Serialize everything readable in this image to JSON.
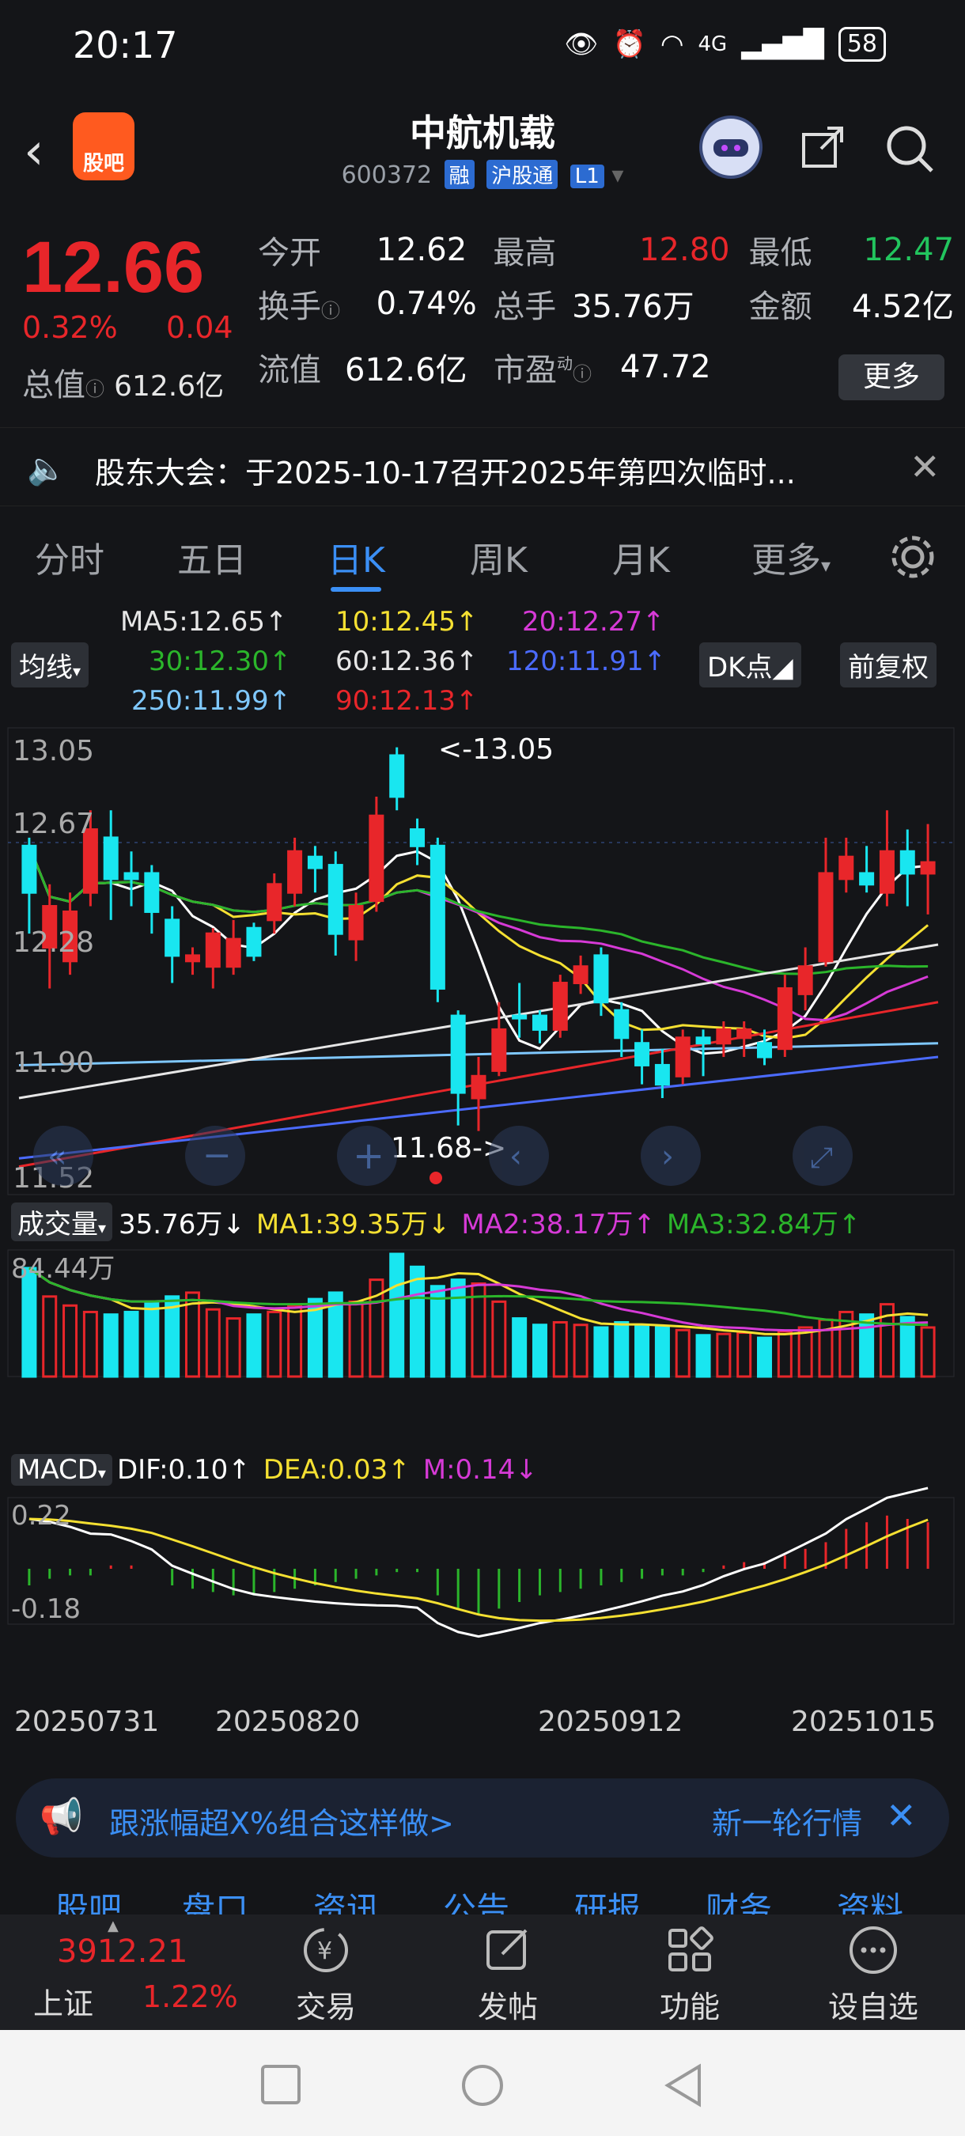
{
  "status_bar": {
    "time": "20:17",
    "network": "4G",
    "battery": "58"
  },
  "header": {
    "back_icon": "chevron-left-icon",
    "logo_text": "股吧",
    "title": "中航机载",
    "code": "600372",
    "tags": [
      "融",
      "沪股通",
      "L1"
    ],
    "icons": [
      "robot-avatar-icon",
      "share-icon",
      "search-icon"
    ]
  },
  "quote": {
    "price": "12.66",
    "change_pct": "0.32%",
    "change_abs": "0.04",
    "rows": [
      [
        {
          "label": "今开",
          "value": "12.62",
          "color": "#ffffff"
        },
        {
          "label": "最高",
          "value": "12.80",
          "color": "#e8262a"
        },
        {
          "label": "最低",
          "value": "12.47",
          "color": "#22c55e"
        }
      ],
      [
        {
          "label": "换手",
          "value": "0.74%",
          "color": "#ffffff"
        },
        {
          "label": "总手",
          "value": "35.76万",
          "color": "#ffffff"
        },
        {
          "label": "金额",
          "value": "4.52亿",
          "color": "#ffffff"
        }
      ]
    ],
    "total_value_label": "总值",
    "total_value": "612.6亿",
    "float_label": "流值",
    "float_value": "612.6亿",
    "pe_label": "市盈",
    "pe_sup": "动",
    "pe_value": "47.72",
    "more_label": "更多"
  },
  "notice": {
    "text": "股东大会：于2025-10-17召开2025年第四次临时..."
  },
  "tabs": [
    "分时",
    "五日",
    "日K",
    "周K",
    "月K",
    "更多"
  ],
  "active_tab": "日K",
  "ma_legend": {
    "selector": "均线",
    "items": [
      {
        "text": "MA5:12.65↑",
        "color": "#ffffff"
      },
      {
        "text": "10:12.45↑",
        "color": "#f5e032"
      },
      {
        "text": "20:12.27↑",
        "color": "#d63ad6"
      },
      {
        "text": "30:12.30↑",
        "color": "#2bb52b"
      },
      {
        "text": "60:12.36↑",
        "color": "#e6e6e6"
      },
      {
        "text": "120:11.91↑",
        "color": "#4b6bff"
      },
      {
        "text": "250:11.99↑",
        "color": "#7fc8ff"
      },
      {
        "text": "90:12.13↑",
        "color": "#e8262a"
      }
    ],
    "dk_button": "DK点",
    "adjust_button": "前复权"
  },
  "kline": {
    "y_labels": [
      "13.05",
      "12.67",
      "12.28",
      "11.90",
      "11.52"
    ],
    "high_annotation": "<-13.05",
    "low_annotation": "11.68->"
  },
  "volume_legend": {
    "selector": "成交量",
    "value": "35.76万↓",
    "ma1": "MA1:39.35万↓",
    "ma2": "MA2:38.17万↑",
    "ma3": "MA3:32.84万↑",
    "y_label": "84.44万"
  },
  "macd_legend": {
    "selector": "MACD",
    "dif": "DIF:0.10↑",
    "dea": "DEA:0.03↑",
    "m": "M:0.14↓",
    "y_top": "0.22",
    "y_bottom": "-0.18"
  },
  "dates": [
    "20250731",
    "20250820",
    "20250912",
    "20251015"
  ],
  "ad_banner": {
    "text": "跟涨幅超X%组合这样做>",
    "text2": "新一轮行情"
  },
  "subtabs": [
    "股吧",
    "盘口",
    "资讯",
    "公告",
    "研报",
    "财务",
    "资料"
  ],
  "bottom_bar": {
    "index_value": "3912.21",
    "index_name": "上证",
    "index_change": "1.22%",
    "items": [
      {
        "label": "交易",
        "icon": "yuan-exchange-icon"
      },
      {
        "label": "发帖",
        "icon": "compose-icon"
      },
      {
        "label": "功能",
        "icon": "grid-icon"
      },
      {
        "label": "设自选",
        "icon": "more-circle-icon"
      }
    ]
  },
  "chart_data": {
    "type": "candlestick",
    "ylim": [
      11.52,
      13.05
    ],
    "candles": [
      {
        "o": 12.55,
        "c": 12.72,
        "h": 12.75,
        "l": 12.4,
        "up": false
      },
      {
        "o": 12.5,
        "c": 12.35,
        "h": 12.58,
        "l": 12.2,
        "up": true
      },
      {
        "o": 12.3,
        "c": 12.48,
        "h": 12.55,
        "l": 12.25,
        "up": true
      },
      {
        "o": 12.55,
        "c": 12.78,
        "h": 12.85,
        "l": 12.5,
        "up": true
      },
      {
        "o": 12.75,
        "c": 12.6,
        "h": 12.85,
        "l": 12.45,
        "up": false
      },
      {
        "o": 12.62,
        "c": 12.6,
        "h": 12.7,
        "l": 12.5,
        "up": false
      },
      {
        "o": 12.62,
        "c": 12.48,
        "h": 12.65,
        "l": 12.4,
        "up": false
      },
      {
        "o": 12.45,
        "c": 12.32,
        "h": 12.5,
        "l": 12.22,
        "up": false
      },
      {
        "o": 12.3,
        "c": 12.32,
        "h": 12.35,
        "l": 12.25,
        "up": true
      },
      {
        "o": 12.28,
        "c": 12.4,
        "h": 12.42,
        "l": 12.2,
        "up": true
      },
      {
        "o": 12.38,
        "c": 12.28,
        "h": 12.45,
        "l": 12.25,
        "up": true
      },
      {
        "o": 12.32,
        "c": 12.42,
        "h": 12.44,
        "l": 12.3,
        "up": false
      },
      {
        "o": 12.45,
        "c": 12.58,
        "h": 12.62,
        "l": 12.4,
        "up": true
      },
      {
        "o": 12.55,
        "c": 12.7,
        "h": 12.75,
        "l": 12.5,
        "up": true
      },
      {
        "o": 12.68,
        "c": 12.64,
        "h": 12.72,
        "l": 12.55,
        "up": false
      },
      {
        "o": 12.65,
        "c": 12.4,
        "h": 12.7,
        "l": 12.32,
        "up": false
      },
      {
        "o": 12.38,
        "c": 12.5,
        "h": 12.55,
        "l": 12.3,
        "up": true
      },
      {
        "o": 12.52,
        "c": 12.83,
        "h": 12.9,
        "l": 12.48,
        "up": true
      },
      {
        "o": 12.9,
        "c": 13.05,
        "h": 13.08,
        "l": 12.85,
        "up": false
      },
      {
        "o": 12.78,
        "c": 12.72,
        "h": 12.82,
        "l": 12.65,
        "up": false
      },
      {
        "o": 12.72,
        "c": 12.2,
        "h": 12.75,
        "l": 12.15,
        "up": false
      },
      {
        "o": 12.1,
        "c": 11.82,
        "h": 12.12,
        "l": 11.7,
        "up": false
      },
      {
        "o": 11.8,
        "c": 11.88,
        "h": 11.95,
        "l": 11.68,
        "up": true
      },
      {
        "o": 11.9,
        "c": 12.05,
        "h": 12.15,
        "l": 11.88,
        "up": true
      },
      {
        "o": 12.1,
        "c": 12.1,
        "h": 12.22,
        "l": 12.02,
        "up": false
      },
      {
        "o": 12.1,
        "c": 12.05,
        "h": 12.12,
        "l": 12.0,
        "up": false
      },
      {
        "o": 12.05,
        "c": 12.22,
        "h": 12.25,
        "l": 12.02,
        "up": true
      },
      {
        "o": 12.22,
        "c": 12.28,
        "h": 12.32,
        "l": 12.18,
        "up": true
      },
      {
        "o": 12.32,
        "c": 12.15,
        "h": 12.35,
        "l": 12.1,
        "up": false
      },
      {
        "o": 12.12,
        "c": 12.02,
        "h": 12.15,
        "l": 11.95,
        "up": false
      },
      {
        "o": 12.0,
        "c": 11.92,
        "h": 12.05,
        "l": 11.85,
        "up": false
      },
      {
        "o": 11.92,
        "c": 11.85,
        "h": 11.98,
        "l": 11.8,
        "up": false
      },
      {
        "o": 11.88,
        "c": 12.02,
        "h": 12.05,
        "l": 11.85,
        "up": true
      },
      {
        "o": 12.02,
        "c": 12.0,
        "h": 12.05,
        "l": 11.88,
        "up": false
      },
      {
        "o": 12.0,
        "c": 12.05,
        "h": 12.08,
        "l": 11.95,
        "up": true
      },
      {
        "o": 12.05,
        "c": 12.02,
        "h": 12.08,
        "l": 11.95,
        "up": true
      },
      {
        "o": 12.0,
        "c": 11.95,
        "h": 12.05,
        "l": 11.92,
        "up": false
      },
      {
        "o": 11.98,
        "c": 12.2,
        "h": 12.25,
        "l": 11.95,
        "up": true
      },
      {
        "o": 12.18,
        "c": 12.28,
        "h": 12.35,
        "l": 12.12,
        "up": true
      },
      {
        "o": 12.3,
        "c": 12.62,
        "h": 12.75,
        "l": 12.28,
        "up": true
      },
      {
        "o": 12.6,
        "c": 12.68,
        "h": 12.75,
        "l": 12.55,
        "up": true
      },
      {
        "o": 12.62,
        "c": 12.58,
        "h": 12.72,
        "l": 12.55,
        "up": false
      },
      {
        "o": 12.55,
        "c": 12.7,
        "h": 12.85,
        "l": 12.5,
        "up": true
      },
      {
        "o": 12.7,
        "c": 12.62,
        "h": 12.78,
        "l": 12.5,
        "up": false
      },
      {
        "o": 12.62,
        "c": 12.66,
        "h": 12.8,
        "l": 12.47,
        "up": true
      }
    ],
    "volume": [
      84,
      62,
      55,
      50,
      48,
      50,
      58,
      62,
      65,
      52,
      45,
      48,
      50,
      55,
      60,
      65,
      58,
      75,
      95,
      85,
      70,
      75,
      72,
      58,
      45,
      40,
      42,
      40,
      38,
      42,
      40,
      38,
      36,
      32,
      33,
      34,
      30,
      35,
      38,
      44,
      50,
      48,
      56,
      46,
      38
    ],
    "macd_hist": [
      -0.05,
      -0.03,
      -0.02,
      -0.02,
      0.01,
      0.01,
      0.0,
      -0.05,
      -0.06,
      -0.07,
      -0.08,
      -0.08,
      -0.07,
      -0.06,
      -0.05,
      -0.04,
      -0.03,
      -0.02,
      -0.01,
      -0.01,
      -0.08,
      -0.12,
      -0.14,
      -0.12,
      -0.1,
      -0.08,
      -0.07,
      -0.06,
      -0.05,
      -0.04,
      -0.03,
      -0.02,
      -0.02,
      -0.01,
      0.01,
      0.02,
      0.02,
      0.04,
      0.06,
      0.08,
      0.12,
      0.14,
      0.16,
      0.15,
      0.14
    ]
  }
}
